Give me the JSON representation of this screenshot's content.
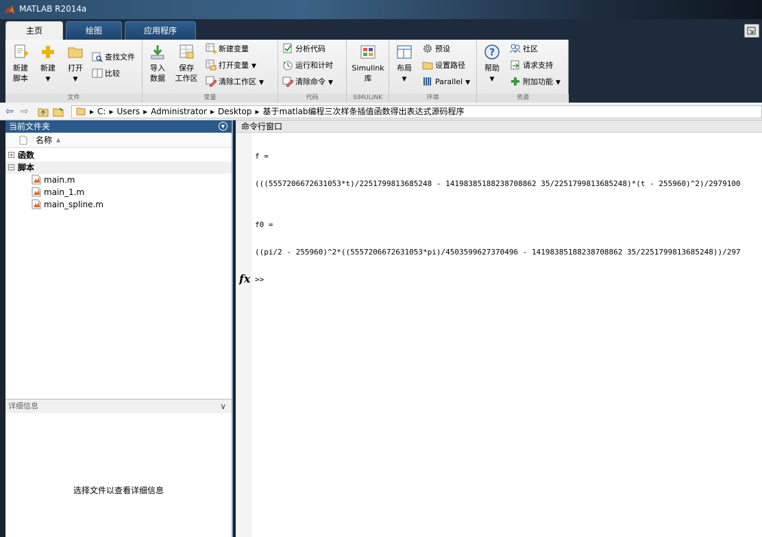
{
  "window": {
    "title": "MATLAB R2014a"
  },
  "tabs": [
    {
      "label": "主页",
      "active": true
    },
    {
      "label": "绘图",
      "active": false
    },
    {
      "label": "应用程序",
      "active": false
    }
  ],
  "ribbon": {
    "file_group": {
      "name": "文件",
      "new_script": [
        "新建",
        "脚本"
      ],
      "new": "新建",
      "open": "打开",
      "find_files": "查找文件",
      "compare": "比较"
    },
    "variable_group": {
      "name": "变量",
      "import": [
        "导入",
        "数据"
      ],
      "save": [
        "保存",
        "工作区"
      ],
      "new_variable": "新建变量",
      "open_variable": "打开变量",
      "clear_workspace": "清除工作区"
    },
    "code_group": {
      "name": "代码",
      "analyze": "分析代码",
      "run_time": "运行和计时",
      "clear_commands": "清除命令"
    },
    "simulink_group": {
      "name": "SIMULINK",
      "simulink": [
        "Simulink",
        "库"
      ]
    },
    "env_group": {
      "name": "环境",
      "layout": "布局",
      "preferences": "预设",
      "set_path": "设置路径",
      "parallel": "Parallel"
    },
    "resources_group": {
      "name": "资源",
      "help": "帮助",
      "community": "社区",
      "request_support": "请求支持",
      "addons": "附加功能"
    }
  },
  "address": {
    "crumbs": [
      "C:",
      "Users",
      "Administrator",
      "Desktop",
      "基于matlab编程三次样条插值函数得出表达式源码程序"
    ]
  },
  "current_folder": {
    "title": "当前文件夹",
    "column_name": "名称",
    "tree": [
      {
        "label": "函数",
        "expanded": false
      },
      {
        "label": "脚本",
        "expanded": true
      }
    ],
    "files": [
      "main.m",
      "main_1.m",
      "main_spline.m"
    ]
  },
  "details": {
    "title": "详细信息",
    "message": "选择文件以查看详细信息"
  },
  "command_window": {
    "title": "命令行窗口",
    "lines": [
      "f =",
      "(((5557206672631053*t)/2251799813685248 - 14198385188238708862 35/2251799813685248)*(t - 255960)^2)/2979100",
      "f0 =",
      "((pi/2 - 255960)^2*((5557206672631053*pi)/4503599627370496 - 14198385188238708862 35/2251799813685248))/297"
    ],
    "prompt": ">>",
    "fx": "fx"
  }
}
